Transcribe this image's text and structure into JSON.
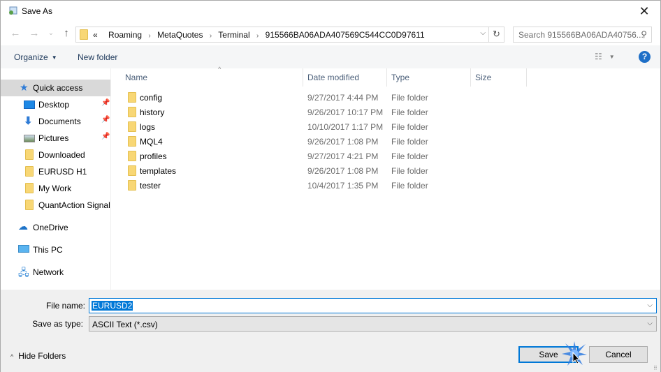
{
  "window": {
    "title": "Save As",
    "close_icon": "close-icon"
  },
  "nav": {
    "back_icon": "←",
    "forward_icon": "→",
    "recent_icon": "⌄",
    "up_icon": "↑",
    "address": {
      "overflow": "«",
      "crumbs": [
        "Roaming",
        "MetaQuotes",
        "Terminal",
        "915566BA06ADA407569C544CC0D97611"
      ],
      "separator": "›"
    },
    "search_placeholder": "Search 915566BA06ADA40756..."
  },
  "toolbar": {
    "organize_label": "Organize",
    "new_folder_label": "New folder",
    "help_label": "?"
  },
  "sidebar": {
    "items": [
      {
        "label": "Quick access",
        "icon": "star-icon",
        "selected": true,
        "pinned": false
      },
      {
        "label": "Desktop",
        "icon": "desktop-icon",
        "pinned": true
      },
      {
        "label": "Documents",
        "icon": "download-arrow-icon",
        "pinned": true
      },
      {
        "label": "Pictures",
        "icon": "pictures-icon",
        "pinned": true
      },
      {
        "label": "Downloaded",
        "icon": "folder-icon",
        "pinned": false
      },
      {
        "label": "EURUSD H1",
        "icon": "folder-icon",
        "pinned": false
      },
      {
        "label": "My Work",
        "icon": "folder-icon",
        "pinned": false
      },
      {
        "label": "QuantAction Signal",
        "icon": "folder-icon",
        "pinned": false
      },
      {
        "label": "OneDrive",
        "icon": "cloud-icon"
      },
      {
        "label": "This PC",
        "icon": "computer-icon"
      },
      {
        "label": "Network",
        "icon": "network-icon"
      }
    ]
  },
  "filelist": {
    "columns": [
      "Name",
      "Date modified",
      "Type",
      "Size"
    ],
    "rows": [
      {
        "name": "config",
        "date": "9/27/2017 4:44 PM",
        "type": "File folder"
      },
      {
        "name": "history",
        "date": "9/26/2017 10:17 PM",
        "type": "File folder"
      },
      {
        "name": "logs",
        "date": "10/10/2017 1:17 PM",
        "type": "File folder"
      },
      {
        "name": "MQL4",
        "date": "9/26/2017 1:08 PM",
        "type": "File folder"
      },
      {
        "name": "profiles",
        "date": "9/27/2017 4:21 PM",
        "type": "File folder"
      },
      {
        "name": "templates",
        "date": "9/26/2017 1:08 PM",
        "type": "File folder"
      },
      {
        "name": "tester",
        "date": "10/4/2017 1:35 PM",
        "type": "File folder"
      }
    ]
  },
  "bottom": {
    "file_name_label": "File name:",
    "file_name_value": "EURUSD2",
    "save_type_label": "Save as type:",
    "save_type_value": "ASCII Text (*.csv)",
    "hide_folders_label": "Hide Folders",
    "save_label": "Save",
    "cancel_label": "Cancel"
  },
  "colors": {
    "accent": "#0078d7",
    "selection": "#d9d9d9",
    "folder": "#f8d775"
  }
}
